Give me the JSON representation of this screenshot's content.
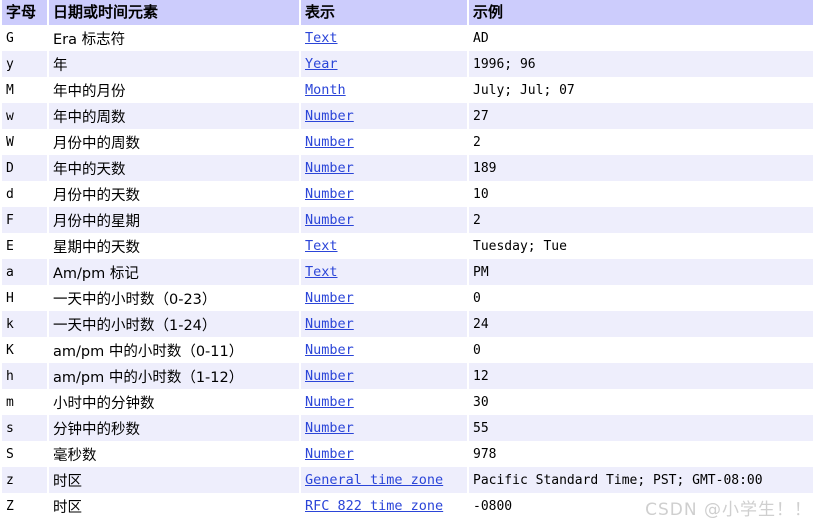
{
  "table": {
    "columns": [
      {
        "key": "letter",
        "label": "字母"
      },
      {
        "key": "element",
        "label": "日期或时间元素"
      },
      {
        "key": "present",
        "label": "表示"
      },
      {
        "key": "example",
        "label": "示例"
      }
    ],
    "header_bg": "#ccccfc",
    "alt_row_bg": "#eeeefc",
    "link_color": "#2b45d8",
    "rows": [
      {
        "letter": "G",
        "element": "Era 标志符",
        "present": "Text",
        "example": "AD"
      },
      {
        "letter": "y",
        "element": "年",
        "present": "Year",
        "example": "1996; 96"
      },
      {
        "letter": "M",
        "element": "年中的月份",
        "present": "Month",
        "example": "July; Jul; 07"
      },
      {
        "letter": "w",
        "element": "年中的周数",
        "present": "Number",
        "example": "27"
      },
      {
        "letter": "W",
        "element": "月份中的周数",
        "present": "Number",
        "example": "2"
      },
      {
        "letter": "D",
        "element": "年中的天数",
        "present": "Number",
        "example": "189"
      },
      {
        "letter": "d",
        "element": "月份中的天数",
        "present": "Number",
        "example": "10"
      },
      {
        "letter": "F",
        "element": "月份中的星期",
        "present": "Number",
        "example": "2"
      },
      {
        "letter": "E",
        "element": "星期中的天数",
        "present": "Text",
        "example": "Tuesday; Tue"
      },
      {
        "letter": "a",
        "element": "Am/pm 标记",
        "present": "Text",
        "example": "PM"
      },
      {
        "letter": "H",
        "element": "一天中的小时数（0-23）",
        "present": "Number",
        "example": "0"
      },
      {
        "letter": "k",
        "element": "一天中的小时数（1-24）",
        "present": "Number",
        "example": "24"
      },
      {
        "letter": "K",
        "element": "am/pm 中的小时数（0-11）",
        "present": "Number",
        "example": "0"
      },
      {
        "letter": "h",
        "element": "am/pm 中的小时数（1-12）",
        "present": "Number",
        "example": "12"
      },
      {
        "letter": "m",
        "element": "小时中的分钟数",
        "present": "Number",
        "example": "30"
      },
      {
        "letter": "s",
        "element": "分钟中的秒数",
        "present": "Number",
        "example": "55"
      },
      {
        "letter": "S",
        "element": "毫秒数",
        "present": "Number",
        "example": "978"
      },
      {
        "letter": "z",
        "element": "时区",
        "present": "General time zone",
        "example": "Pacific Standard Time; PST; GMT-08:00"
      },
      {
        "letter": "Z",
        "element": "时区",
        "present": "RFC 822 time zone",
        "example": "-0800"
      }
    ]
  },
  "watermark": {
    "text": "CSDN @小学生！！"
  }
}
